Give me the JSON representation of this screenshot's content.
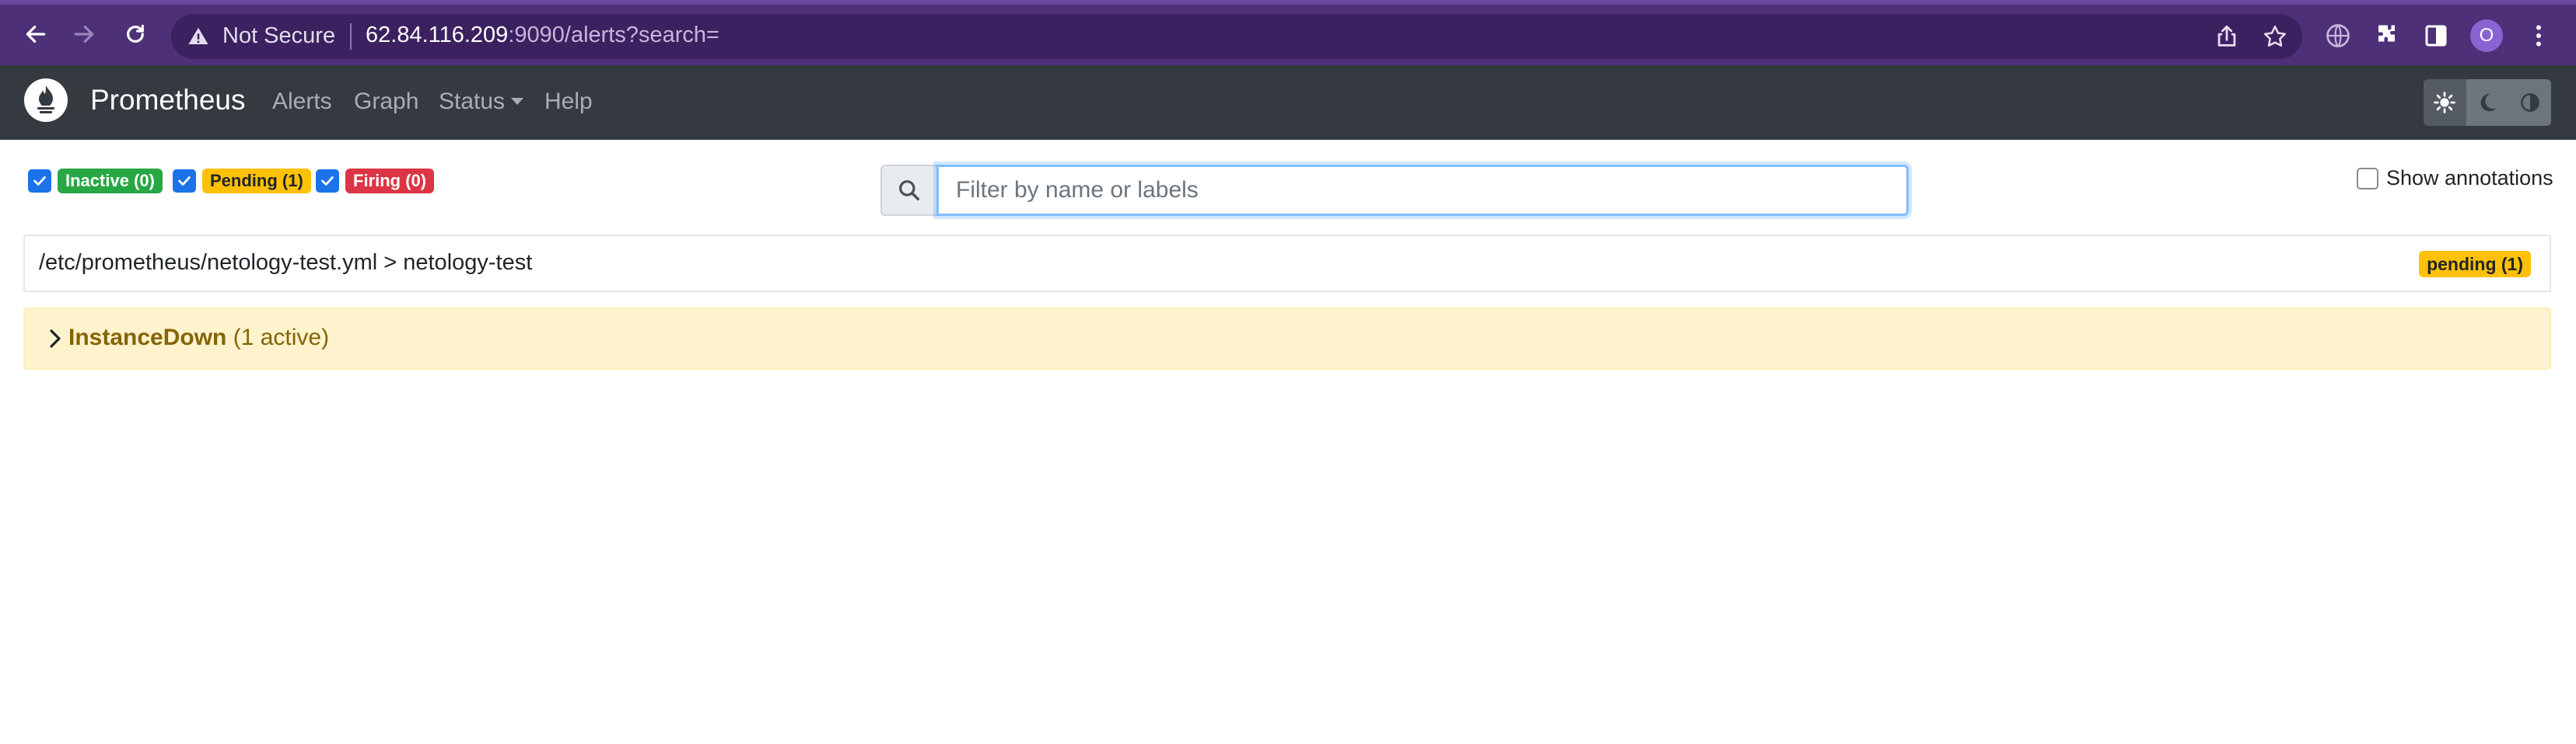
{
  "browser": {
    "security_label": "Not Secure",
    "url_host": "62.84.116.209",
    "url_rest": ":9090/alerts?search=",
    "profile_initial": "O"
  },
  "navbar": {
    "brand": "Prometheus",
    "links": [
      "Alerts",
      "Graph",
      "Status",
      "Help"
    ]
  },
  "filters": {
    "inactive": "Inactive (0)",
    "pending": "Pending (1)",
    "firing": "Firing (0)"
  },
  "search": {
    "placeholder": "Filter by name or labels",
    "value": ""
  },
  "annotations": {
    "label": "Show annotations",
    "checked": false
  },
  "rule_group": {
    "path": "/etc/prometheus/netology-test.yml > netology-test",
    "badge": "pending (1)",
    "alert": {
      "name": "InstanceDown",
      "count": "(1 active)"
    }
  },
  "colors": {
    "chrome": "#4e3078",
    "navbar": "#343a40",
    "inactive": "#28a745",
    "pending": "#ffc107",
    "firing": "#dc3545",
    "alert_bg": "#fff3cd"
  }
}
